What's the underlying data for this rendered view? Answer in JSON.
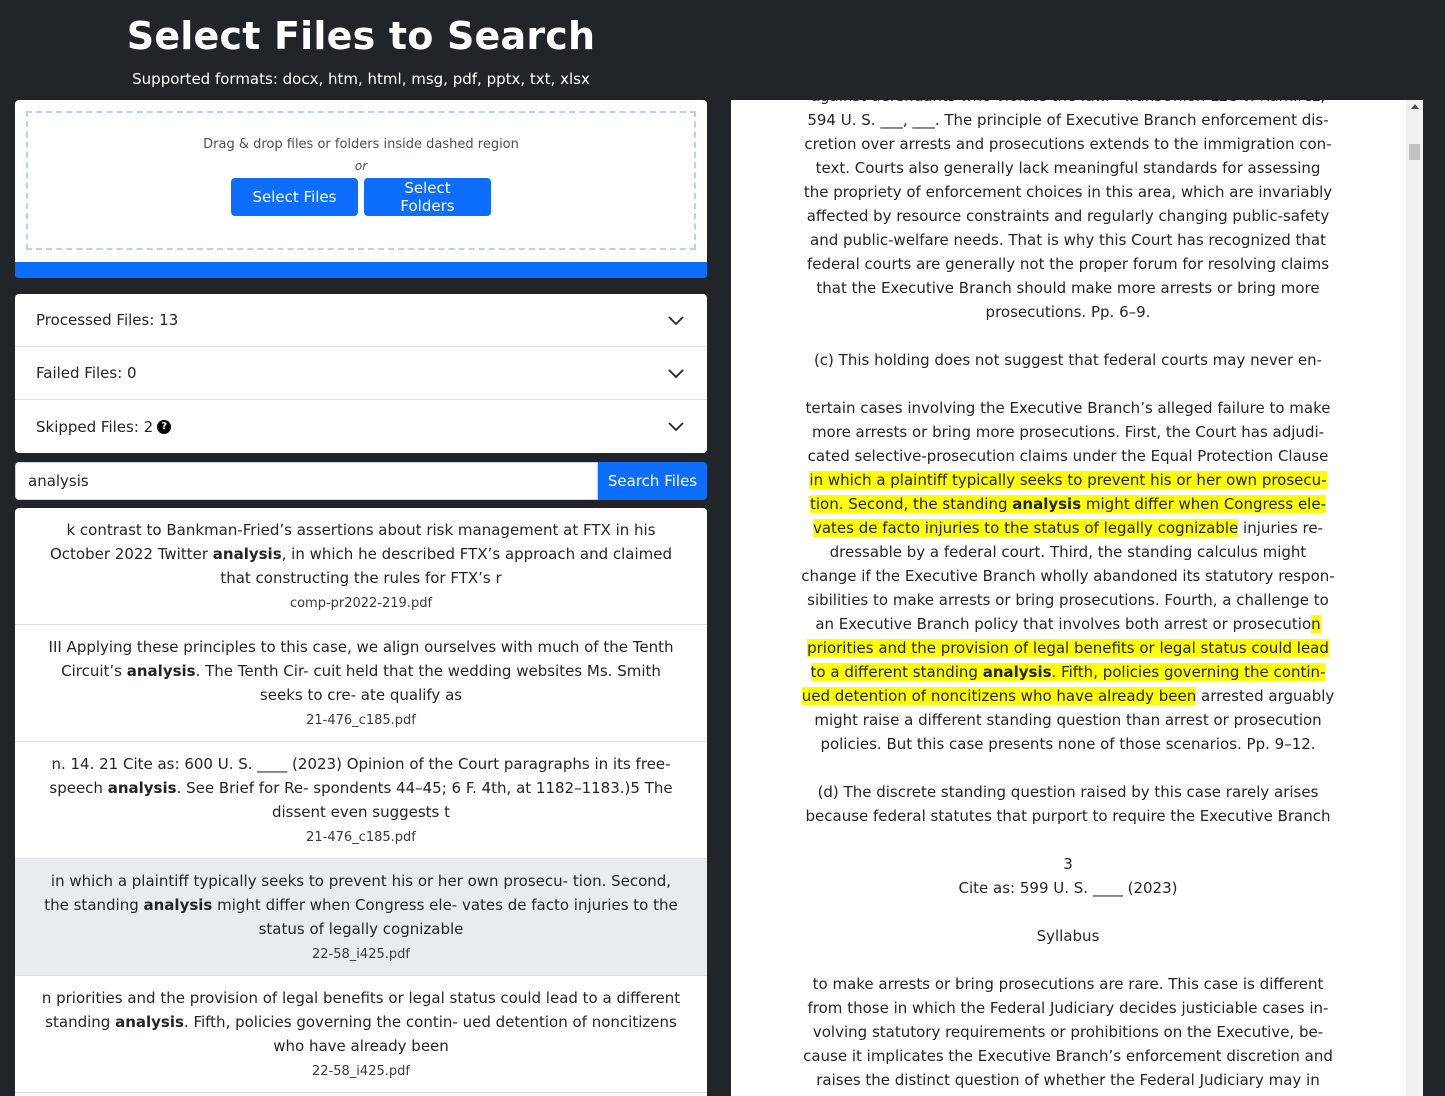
{
  "header": {
    "title": "Select Files to Search",
    "subtitle": "Supported formats: docx, htm, html, msg, pdf, pptx, txt, xlsx"
  },
  "dropzone": {
    "instruction": "Drag & drop files or folders inside dashed region",
    "or": "or",
    "select_files_label": "Select Files",
    "select_folders_label": "Select Folders"
  },
  "accordion": {
    "processed": "Processed Files: 13",
    "failed": "Failed Files: 0",
    "skipped": "Skipped Files: 2",
    "help_glyph": "?"
  },
  "search": {
    "value": "analysis",
    "button_label": "Search Files"
  },
  "results": [
    {
      "before": "k contrast to Bankman-Fried’s assertions about risk management at FTX in his October 2022 Twitter ",
      "keyword": "analysis",
      "after": ", in which he described FTX’s approach and claimed that constructing the rules for FTX’s r",
      "file": "comp-pr2022-219.pdf"
    },
    {
      "before": "III Applying these principles to this case, we align ourselves with much of the Tenth Circuit’s ",
      "keyword": "analysis",
      "after": ". The Tenth Cir- cuit held that the wedding websites Ms. Smith seeks to cre- ate qualify as",
      "file": "21-476_c185.pdf"
    },
    {
      "before": "n. 14. 21 Cite as: 600 U. S. ____ (2023) Opinion of the Court paragraphs in its free-speech ",
      "keyword": "analysis",
      "after": ". See Brief for Re- spondents 44–45; 6 F. 4th, at 1182–1183.)5 The dissent even suggests t",
      "file": "21-476_c185.pdf"
    },
    {
      "before": "in which a plaintiff typically seeks to prevent his or her own prosecu- tion. Second, the standing ",
      "keyword": "analysis",
      "after": " might differ when Congress ele- vates de facto injuries to the status of legally cognizable",
      "file": "22-58_i425.pdf"
    },
    {
      "before": "n priorities and the provision of legal benefits or legal status could lead to a different standing ",
      "keyword": "analysis",
      "after": ". Fifth, policies governing the contin- ued detention of noncitizens who have already been",
      "file": "22-58_i425.pdf"
    }
  ],
  "document": {
    "lines": [
      [
        {
          "t": "against defendants who violate the law.” TransUnion LLC v. Ramirez,"
        }
      ],
      [
        {
          "t": "594 U. S. ___, ___. The principle of Executive Branch enforcement dis-"
        }
      ],
      [
        {
          "t": "cretion over arrests and prosecutions extends to the immigration con-"
        }
      ],
      [
        {
          "t": "text. Courts also generally lack meaningful standards for assessing"
        }
      ],
      [
        {
          "t": "the propriety of enforcement choices in this area, which are invariably"
        }
      ],
      [
        {
          "t": "affected by resource constraints and regularly changing public-safety"
        }
      ],
      [
        {
          "t": "and public-welfare needs. That is why this Court has recognized that"
        }
      ],
      [
        {
          "t": "federal courts are generally not the proper forum for resolving claims"
        }
      ],
      [
        {
          "t": "that the Executive Branch should make more arrests or bring more"
        }
      ],
      [
        {
          "t": "prosecutions. Pp. 6–9."
        }
      ],
      [],
      [
        {
          "t": "(c) This holding does not suggest that federal courts may never en-"
        }
      ],
      [],
      [
        {
          "t": "tertain cases involving the Executive Branch’s alleged failure to make"
        }
      ],
      [
        {
          "t": "more arrests or bring more prosecutions. First, the Court has adjudi-"
        }
      ],
      [
        {
          "t": "cated selective-prosecution claims under the Equal Protection Clause"
        }
      ],
      [
        {
          "t": "in which a plaintiff typically seeks to prevent his or her own prosecu-",
          "h": true
        }
      ],
      [
        {
          "t": "tion. Second, the standing ",
          "h": true
        },
        {
          "t": "analysis",
          "h": true,
          "b": true
        },
        {
          "t": " might differ when Congress ele-",
          "h": true
        }
      ],
      [
        {
          "t": "vates de facto injuries to the status of legally cognizable",
          "h": true
        },
        {
          "t": " injuries re-"
        }
      ],
      [
        {
          "t": "dressable by a federal court. Third, the standing calculus might"
        }
      ],
      [
        {
          "t": "change if the Executive Branch wholly abandoned its statutory respon-"
        }
      ],
      [
        {
          "t": "sibilities to make arrests or bring prosecutions. Fourth, a challenge to"
        }
      ],
      [
        {
          "t": "an Executive Branch policy that involves both arrest or prosecutio"
        },
        {
          "t": "n",
          "h": true
        }
      ],
      [
        {
          "t": "priorities and the provision of legal benefits or legal status could lead",
          "h": true
        }
      ],
      [
        {
          "t": "to a different standing ",
          "h": true
        },
        {
          "t": "analysis",
          "h": true,
          "b": true
        },
        {
          "t": ". Fifth, policies governing the contin-",
          "h": true
        }
      ],
      [
        {
          "t": "ued detention of noncitizens who have already been",
          "h": true
        },
        {
          "t": " arrested arguably"
        }
      ],
      [
        {
          "t": "might raise a different standing question than arrest or prosecution"
        }
      ],
      [
        {
          "t": "policies. But this case presents none of those scenarios. Pp. 9–12."
        }
      ],
      [],
      [
        {
          "t": "(d) The discrete standing question raised by this case rarely arises"
        }
      ],
      [
        {
          "t": "because federal statutes that purport to require the Executive Branch"
        }
      ],
      [],
      [
        {
          "t": "3"
        }
      ],
      [
        {
          "t": "Cite as: 599 U. S. ____ (2023)"
        }
      ],
      [],
      [
        {
          "t": "Syllabus"
        }
      ],
      [],
      [
        {
          "t": "to make arrests or bring prosecutions are rare. This case is different"
        }
      ],
      [
        {
          "t": "from those in which the Federal Judiciary decides justiciable cases in-"
        }
      ],
      [
        {
          "t": "volving statutory requirements or prohibitions on the Executive, be-"
        }
      ],
      [
        {
          "t": "cause it implicates the Executive Branch’s enforcement discretion and"
        }
      ],
      [
        {
          "t": "raises the distinct question of whether the Federal Judiciary may in"
        }
      ]
    ]
  },
  "colors": {
    "background": "#212529",
    "primary": "#0d6efd",
    "highlight": "#ffff00",
    "active_row": "#e9ecef"
  }
}
